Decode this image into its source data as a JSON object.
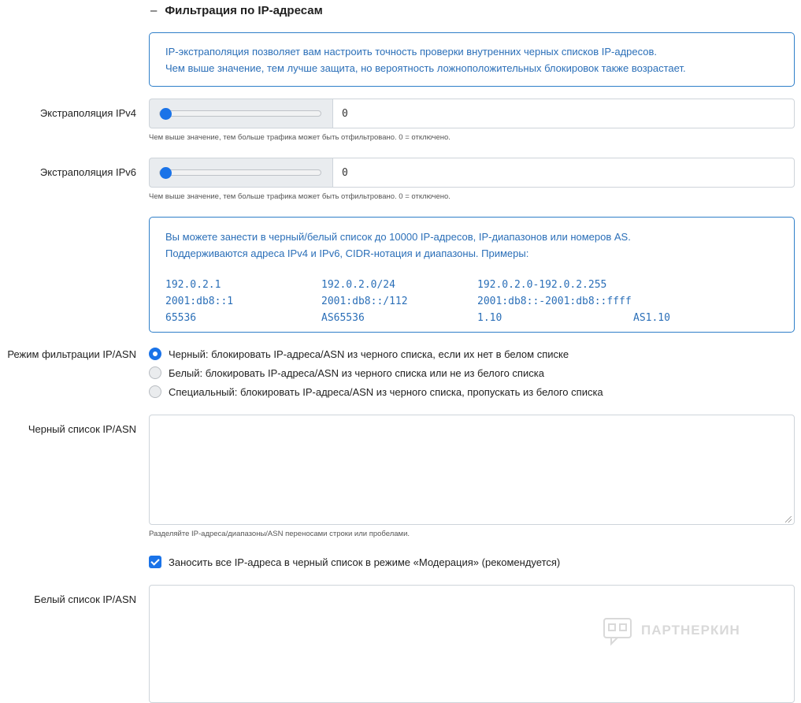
{
  "section": {
    "collapse_glyph": "–",
    "title": "Фильтрация по IP-адресам"
  },
  "info1": {
    "line1": "IP-экстраполяция позволяет вам настроить точность проверки внутренних черных списков IP-адресов.",
    "line2": "Чем выше значение, тем лучше защита, но вероятность ложноположительных блокировок также возрастает."
  },
  "ipv4": {
    "label": "Экстраполяция IPv4",
    "slider_value": 0,
    "value": "0",
    "hint": "Чем выше значение, тем больше трафика может быть отфильтровано. 0 = отключено."
  },
  "ipv6": {
    "label": "Экстраполяция IPv6",
    "slider_value": 0,
    "value": "0",
    "hint": "Чем выше значение, тем больше трафика может быть отфильтровано. 0 = отключено."
  },
  "info2": {
    "line1": "Вы можете занести в черный/белый список до 10000 IP-адресов, IP-диапазонов или номеров AS.",
    "line2": "Поддерживаются адреса IPv4 и IPv6, CIDR-нотация и диапазоны. Примеры:",
    "examples": [
      [
        "192.0.2.1",
        "192.0.2.0/24",
        "192.0.2.0-192.0.2.255"
      ],
      [
        "2001:db8::1",
        "2001:db8::/112",
        "2001:db8::-2001:db8::ffff"
      ],
      [
        "65536",
        "AS65536",
        "1.10",
        "AS1.10"
      ]
    ]
  },
  "mode": {
    "label": "Режим фильтрации IP/ASN",
    "options": [
      {
        "label": "Черный: блокировать IP-адреса/ASN из черного списка, если их нет в белом списке",
        "checked": true
      },
      {
        "label": "Белый: блокировать IP-адреса/ASN из черного списка или не из белого списка",
        "checked": false
      },
      {
        "label": "Специальный: блокировать IP-адреса/ASN из черного списка, пропускать из белого списка",
        "checked": false
      }
    ]
  },
  "blacklist": {
    "label": "Черный список IP/ASN",
    "value": "",
    "hint": "Разделяйте IP-адреса/диапазоны/ASN переносами строки или пробелами."
  },
  "moderation": {
    "label": "Заносить все IP-адреса в черный список в режиме «Модерация» (рекомендуется)",
    "checked": true
  },
  "whitelist": {
    "label": "Белый список IP/ASN",
    "value": ""
  },
  "watermark": {
    "text": "ПАРТНЕРКИН"
  },
  "colors": {
    "accent": "#1a73e8",
    "info_border": "#2f7fc9",
    "info_text": "#2b6fb8"
  }
}
